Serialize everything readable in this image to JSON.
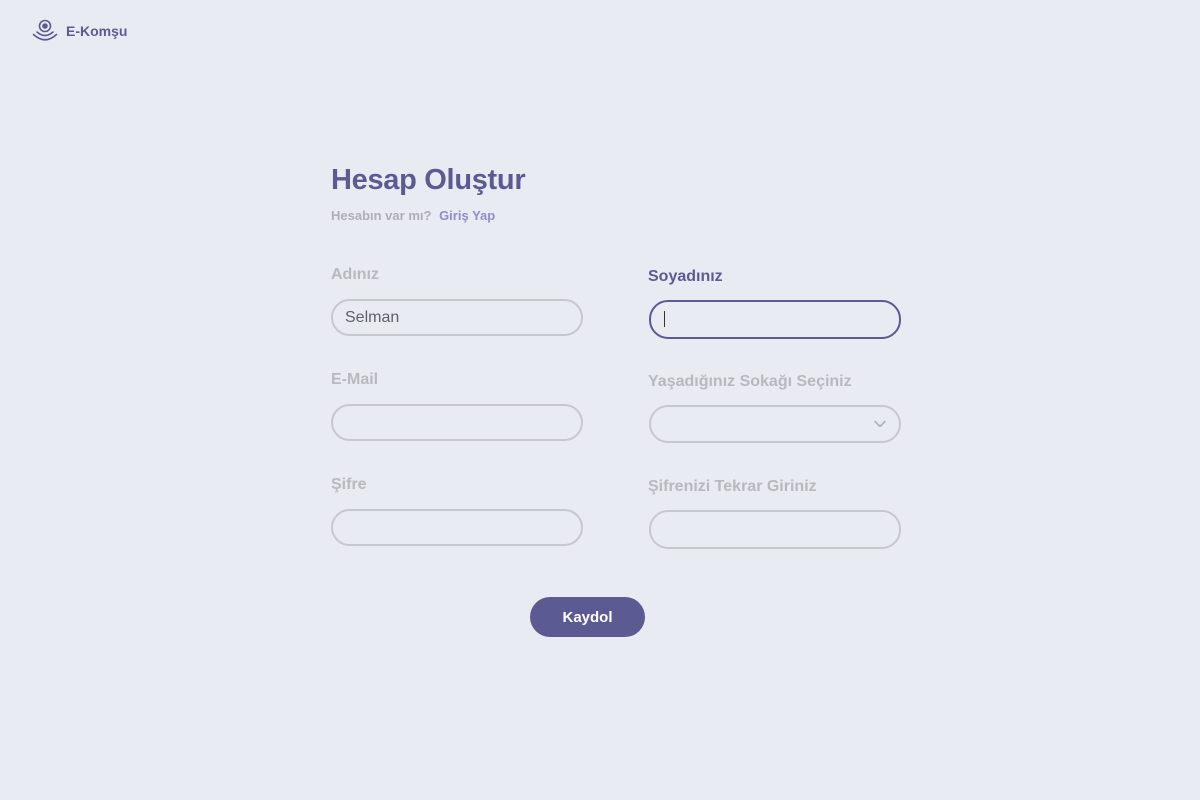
{
  "brand": {
    "name": "E-Komşu",
    "icon": "radar-person-icon",
    "color": "#5c5a93"
  },
  "form": {
    "title": "Hesap Oluştur",
    "subtitle": "Hesabın var mı?",
    "login_link": "Giriş Yap",
    "fields": {
      "first_name": {
        "label": "Adınız",
        "value": "Selman"
      },
      "last_name": {
        "label": "Soyadınız",
        "value": "",
        "focused": true
      },
      "email": {
        "label": "E-Mail",
        "value": ""
      },
      "street": {
        "label": "Yaşadığınız Sokağı Seçiniz",
        "value": "",
        "icon": "chevron-down-icon"
      },
      "password": {
        "label": "Şifre",
        "value": ""
      },
      "password_confirm": {
        "label": "Şifrenizi Tekrar Giriniz",
        "value": ""
      }
    },
    "submit_label": "Kaydol"
  },
  "colors": {
    "background": "#e9ebf3",
    "accent": "#5c5a93",
    "link": "#8f8dc7",
    "muted_label": "#b8b8bd",
    "field_border": "#c8c8cc"
  }
}
